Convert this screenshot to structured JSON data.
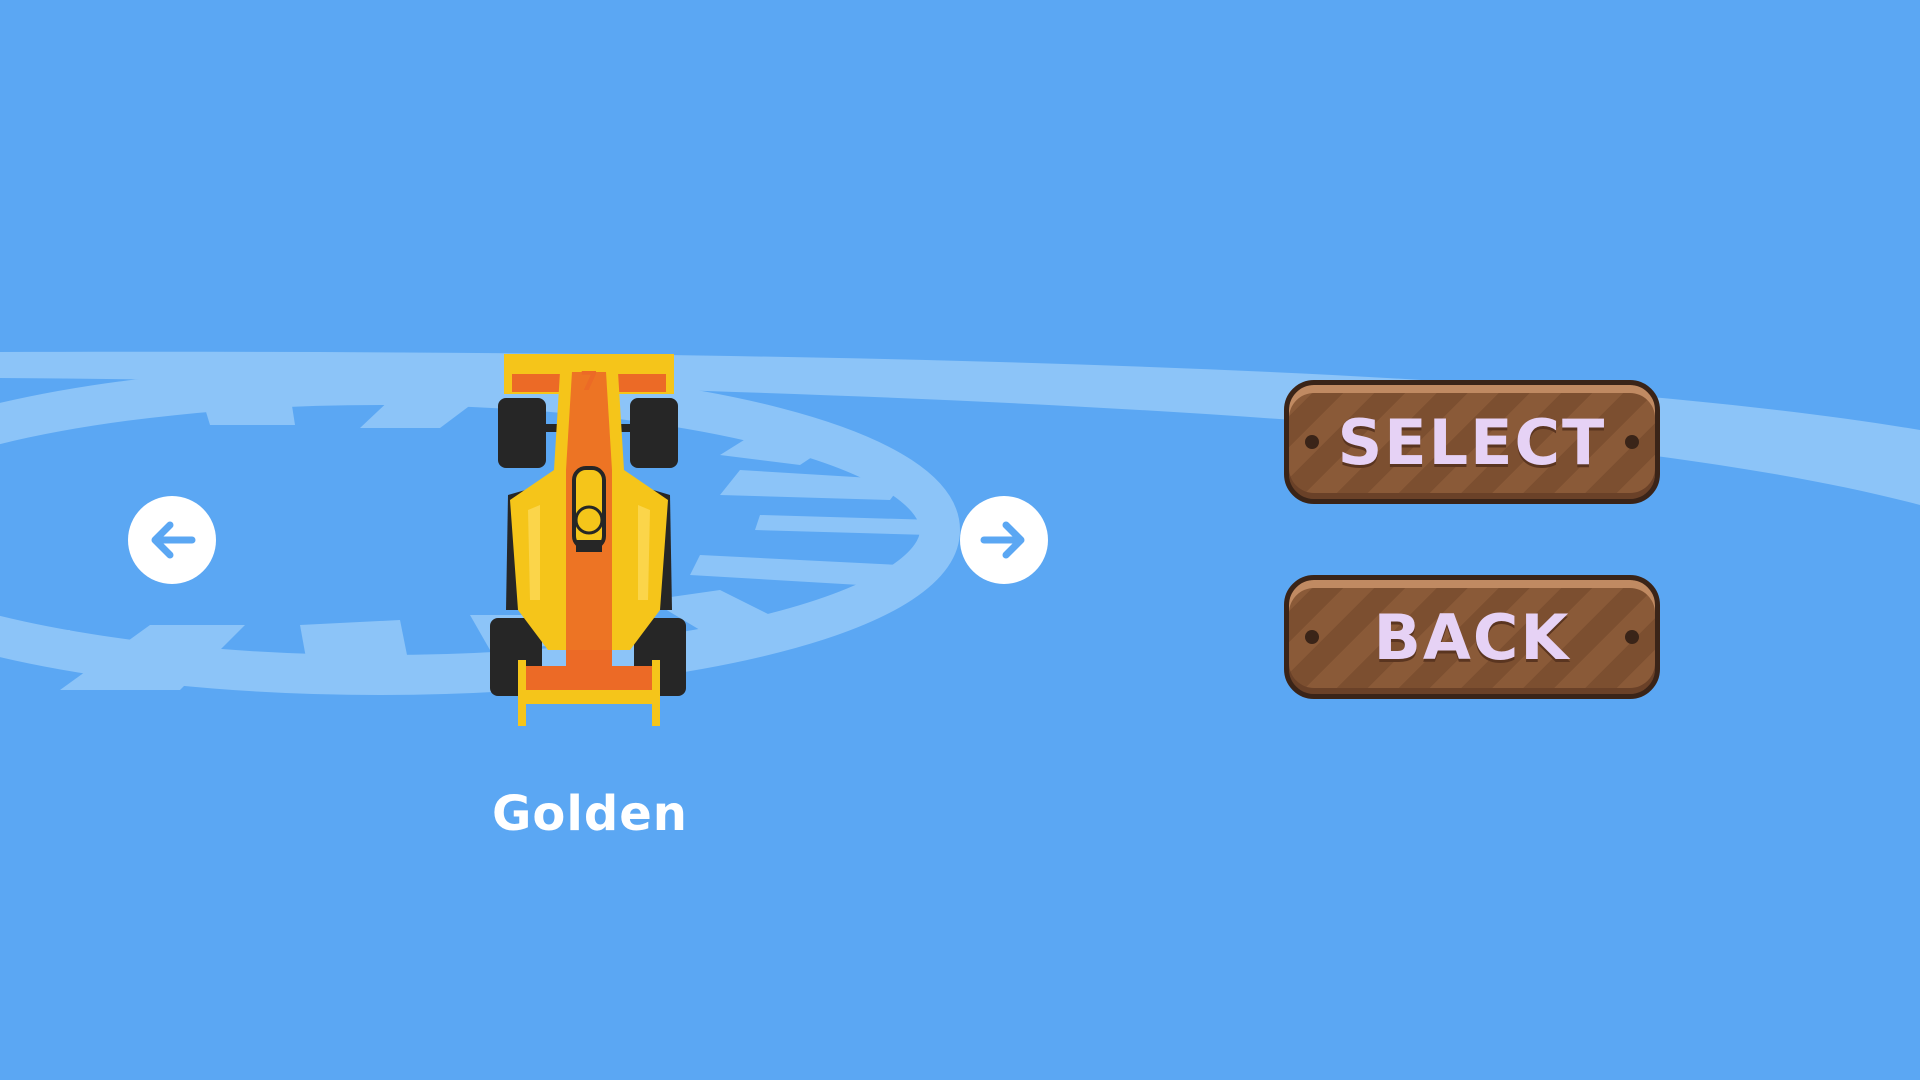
{
  "car_select": {
    "car_name": "Golden",
    "car_number": "7"
  },
  "menu": {
    "select_label": "SELECT",
    "back_label": "BACK"
  },
  "icons": {
    "prev": "arrow-left-icon",
    "next": "arrow-right-icon"
  },
  "colors": {
    "background": "#5ba7f3",
    "track": "#8cc4f8",
    "button_text": "#e6d2f5",
    "wood": "#8a5a38",
    "car_body": "#f5c51a",
    "car_stripe": "#ec6a26"
  }
}
